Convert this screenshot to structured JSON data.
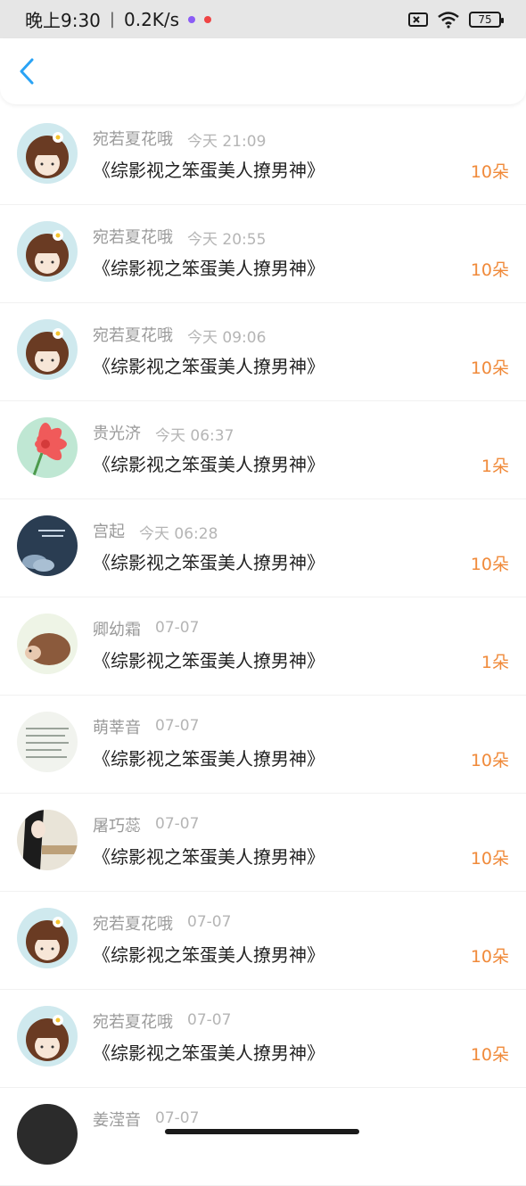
{
  "status_bar": {
    "time": "晚上9:30",
    "network_speed": "0.2K/s",
    "battery": "75",
    "icons": [
      "sim-off-icon",
      "wifi-icon",
      "battery-icon"
    ]
  },
  "nav": {
    "back_icon": "chevron-left-icon"
  },
  "rows": [
    {
      "name": "宛若夏花哦",
      "time": "今天 21:09",
      "title": "《综影视之笨蛋美人撩男神》",
      "count": "10朵",
      "avatar": "girl"
    },
    {
      "name": "宛若夏花哦",
      "time": "今天 20:55",
      "title": "《综影视之笨蛋美人撩男神》",
      "count": "10朵",
      "avatar": "girl"
    },
    {
      "name": "宛若夏花哦",
      "time": "今天 09:06",
      "title": "《综影视之笨蛋美人撩男神》",
      "count": "10朵",
      "avatar": "girl"
    },
    {
      "name": "贵光济",
      "time": "今天 06:37",
      "title": "《综影视之笨蛋美人撩男神》",
      "count": "1朵",
      "avatar": "flower"
    },
    {
      "name": "宫起",
      "time": "今天 06:28",
      "title": "《综影视之笨蛋美人撩男神》",
      "count": "10朵",
      "avatar": "sky"
    },
    {
      "name": "卿幼霜",
      "time": "07-07",
      "title": "《综影视之笨蛋美人撩男神》",
      "count": "1朵",
      "avatar": "hedgehog"
    },
    {
      "name": "萌莘音",
      "time": "07-07",
      "title": "《综影视之笨蛋美人撩男神》",
      "count": "10朵",
      "avatar": "text"
    },
    {
      "name": "屠巧蕊",
      "time": "07-07",
      "title": "《综影视之笨蛋美人撩男神》",
      "count": "10朵",
      "avatar": "anime"
    },
    {
      "name": "宛若夏花哦",
      "time": "07-07",
      "title": "《综影视之笨蛋美人撩男神》",
      "count": "10朵",
      "avatar": "girl"
    },
    {
      "name": "宛若夏花哦",
      "time": "07-07",
      "title": "《综影视之笨蛋美人撩男神》",
      "count": "10朵",
      "avatar": "girl"
    },
    {
      "name": "姜滢音",
      "time": "07-07",
      "title": "",
      "count": "",
      "avatar": "dark"
    }
  ]
}
